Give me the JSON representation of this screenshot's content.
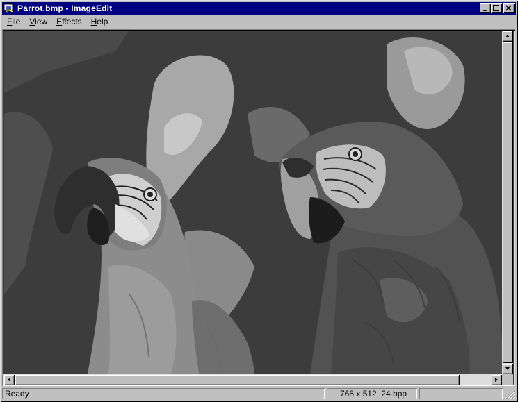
{
  "window": {
    "title": "Parrot.bmp - ImageEdit"
  },
  "menu": {
    "items": [
      {
        "label": "File"
      },
      {
        "label": "View"
      },
      {
        "label": "Effects"
      },
      {
        "label": "Help"
      }
    ]
  },
  "title_buttons": {
    "minimize_icon": "minimize-icon",
    "maximize_icon": "maximize-icon",
    "close_icon": "close-icon"
  },
  "scrollbars": {
    "vertical_position": 0.0,
    "horizontal_position": 0.0
  },
  "status": {
    "ready": "Ready",
    "dimensions": "768 x 512, 24 bpp",
    "extra": ""
  },
  "colors": {
    "titlebar": "#000080",
    "face": "#c0c0c0"
  }
}
